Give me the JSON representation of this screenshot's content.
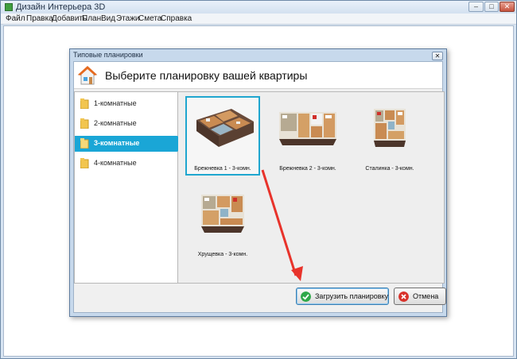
{
  "app": {
    "title": "Дизайн Интерьера 3D",
    "controls": {
      "minimize": "–",
      "maximize": "□",
      "close": "✕"
    }
  },
  "menu": [
    "Файл",
    "Правка",
    "Добавить",
    "План",
    "Вид",
    "Этажи",
    "Смета",
    "Справка"
  ],
  "dialog": {
    "title": "Типовые планировки",
    "close": "✕",
    "heading": "Выберите планировку вашей квартиры",
    "categories": [
      {
        "label": "1-комнатные",
        "selected": false
      },
      {
        "label": "2-комнатные",
        "selected": false
      },
      {
        "label": "3-комнатные",
        "selected": true
      },
      {
        "label": "4-комнатные",
        "selected": false
      }
    ],
    "plans": [
      {
        "label": "Брежневка 1 - 3-комн.",
        "selected": true
      },
      {
        "label": "Брежневка 2 - 3-комн.",
        "selected": false
      },
      {
        "label": "Сталинка - 3-комн.",
        "selected": false
      },
      {
        "label": "Хрущевка - 3-комн.",
        "selected": false
      }
    ],
    "buttons": {
      "load": "Загрузить планировку",
      "cancel": "Отмена"
    }
  },
  "colors": {
    "selection": "#1aa6d6",
    "annotation_arrow": "#e8332b",
    "load_icon": "#2fa84a",
    "cancel_icon": "#d8322b"
  },
  "icons": [
    "house-icon",
    "folder-icon",
    "check-icon",
    "cancel-icon"
  ]
}
